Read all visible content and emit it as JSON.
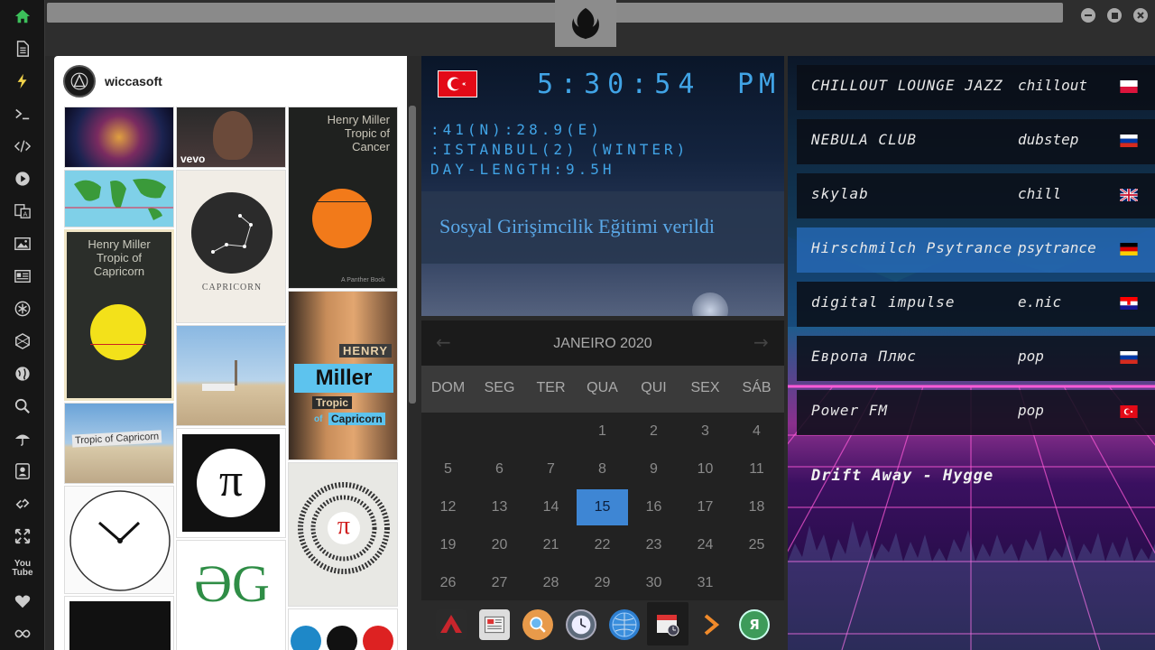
{
  "sidebar": {
    "items": [
      {
        "icon": "home-icon"
      },
      {
        "icon": "document-icon"
      },
      {
        "icon": "lightning-icon"
      },
      {
        "icon": "terminal-icon"
      },
      {
        "icon": "code-icon"
      },
      {
        "icon": "play-icon"
      },
      {
        "icon": "translate-icon"
      },
      {
        "icon": "image-icon"
      },
      {
        "icon": "news-icon"
      },
      {
        "icon": "asterisk-icon"
      },
      {
        "icon": "hexagon-icon"
      },
      {
        "icon": "globe-icon"
      },
      {
        "icon": "search-icon"
      },
      {
        "icon": "umbrella-icon"
      },
      {
        "icon": "contact-icon"
      },
      {
        "icon": "link-icon"
      },
      {
        "icon": "expand-icon"
      },
      {
        "icon": "youtube-icon"
      },
      {
        "icon": "heart-icon"
      },
      {
        "icon": "infinity-icon"
      }
    ],
    "youtube_label": "You Tube"
  },
  "pinterest": {
    "username": "wiccasoft",
    "tiles": {
      "vevo": "vevo",
      "henry_author": "Henry Miller",
      "tropic_of_cancer": "Tropic of Cancer",
      "panther": "A Panther Book",
      "henry_miller_cap": "Henry Miller",
      "tropic_of_capricorn": "Tropic of Capricorn",
      "capricorn": "CAPRICORN",
      "henry_caps": "HENRY",
      "miller": "Miller",
      "tropic": "Tropic",
      "of": "of",
      "capricorn_blue": "Capricorn",
      "sign_text": "Tropic of Capricorn",
      "pi": "π",
      "pi_digits": "3.1415926535",
      "gg": "ƏG"
    }
  },
  "clock": {
    "time": "5:30:54",
    "ampm": "PM",
    "coords": ":41(N):28.9(E)",
    "city": ":ISTANBUL(2) (WINTER)",
    "day_length": "DAY-LENGTH:9.5H",
    "news": "Sosyal Girişimcilik Eğitimi verildi",
    "flag": "turkey-flag",
    "color": "#41a4e6"
  },
  "calendar": {
    "title": "JANEIRO 2020",
    "prev": "←",
    "next": "→",
    "weekdays": [
      "DOM",
      "SEG",
      "TER",
      "QUA",
      "QUI",
      "SEX",
      "SÁB"
    ],
    "weeks": [
      [
        "",
        "",
        "",
        "1",
        "2",
        "3",
        "4"
      ],
      [
        "5",
        "6",
        "7",
        "8",
        "9",
        "10",
        "11"
      ],
      [
        "12",
        "13",
        "14",
        "15",
        "16",
        "17",
        "18"
      ],
      [
        "19",
        "20",
        "21",
        "22",
        "23",
        "24",
        "25"
      ],
      [
        "26",
        "27",
        "28",
        "29",
        "30",
        "31",
        ""
      ]
    ],
    "today": "15",
    "accent": "#3e86d4"
  },
  "dock": {
    "items": [
      {
        "icon": "arc-icon",
        "label": ""
      },
      {
        "icon": "newspaper-icon",
        "label": ""
      },
      {
        "icon": "search-icon",
        "label": ""
      },
      {
        "icon": "clock-icon",
        "label": ""
      },
      {
        "icon": "globe-icon",
        "label": ""
      },
      {
        "icon": "calendar-icon",
        "label": ""
      },
      {
        "icon": "chevron-right-icon",
        "label": ""
      },
      {
        "icon": "yandex-icon",
        "label": "Я"
      }
    ]
  },
  "radio": {
    "stations": [
      {
        "name": "CHILLOUT LOUNGE JAZZ",
        "genre": "chillout",
        "flag": "poland-flag",
        "active": false
      },
      {
        "name": "NEBULA CLUB",
        "genre": "dubstep",
        "flag": "russia-flag",
        "active": false
      },
      {
        "name": "skylab",
        "genre": "chill",
        "flag": "uk-flag",
        "active": false
      },
      {
        "name": "Hirschmilch Psytrance",
        "genre": "psytrance",
        "flag": "germany-flag",
        "active": true
      },
      {
        "name": "digital impulse",
        "genre": "e.nic",
        "flag": "croatia-flag",
        "active": false
      },
      {
        "name": "Европа Плюс",
        "genre": "pop",
        "flag": "russia-flag",
        "active": false
      },
      {
        "name": "Power FM",
        "genre": "pop",
        "flag": "turkey-flag",
        "active": false
      }
    ],
    "now_playing": "Drift Away - Hygge"
  }
}
